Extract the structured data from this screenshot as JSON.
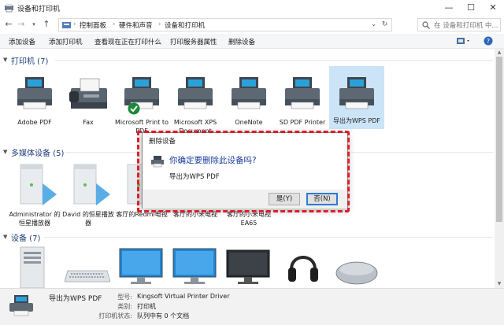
{
  "window": {
    "title": "设备和打印机",
    "minimize": "—",
    "maximize": "☐",
    "close": "✕"
  },
  "address": {
    "crumbs": [
      "控制面板",
      "硬件和声音",
      "设备和打印机"
    ],
    "search_placeholder": "在 设备和打印机 中..."
  },
  "toolbar": {
    "items": [
      "添加设备",
      "添加打印机",
      "查看现在正在打印什么",
      "打印服务器属性",
      "删除设备"
    ]
  },
  "sections": {
    "printers": "打印机 (7)",
    "media": "多媒体设备 (5)",
    "devices": "设备 (7)"
  },
  "printers": [
    {
      "label": "Adobe PDF",
      "icon": "printer-icon"
    },
    {
      "label": "Fax",
      "icon": "fax-icon"
    },
    {
      "label": "Microsoft Print to PDF",
      "icon": "printer-icon",
      "default": true
    },
    {
      "label": "Microsoft XPS Document",
      "icon": "printer-icon"
    },
    {
      "label": "OneNote",
      "icon": "printer-icon"
    },
    {
      "label": "SD PDF Printer",
      "icon": "printer-icon"
    },
    {
      "label": "导出为WPS PDF",
      "icon": "printer-icon",
      "selected": true
    }
  ],
  "media": [
    {
      "label": "Administrator 的恒星播放器"
    },
    {
      "label": "David 的恒星播放器"
    },
    {
      "label": "客厅的Redmi电视"
    },
    {
      "label": "客厅的小米电视"
    },
    {
      "label": "客厅的小米电视 EA65"
    }
  ],
  "dialog": {
    "title": "删除设备",
    "question": "你确定要删除此设备吗?",
    "device": "导出为WPS PDF",
    "yes": "是(Y)",
    "no": "否(N)"
  },
  "details": {
    "name": "导出为WPS PDF",
    "model_key": "型号:",
    "model_val": "Kingsoft Virtual Printer Driver",
    "category_key": "类别:",
    "category_val": "打印机",
    "status_key": "打印机状态:",
    "status_val": "队列中有 0 个文档"
  },
  "colors": {
    "accent": "#1a3b9e",
    "highlight": "#d9202a",
    "selection": "#cce4f7"
  }
}
